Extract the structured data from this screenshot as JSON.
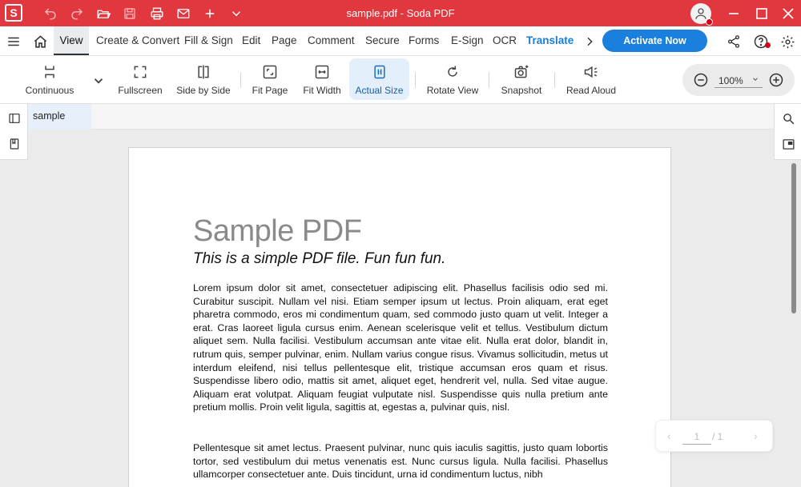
{
  "window": {
    "title": "sample.pdf  -  Soda PDF",
    "app_logo": "S"
  },
  "quick_access": [
    "undo-icon",
    "redo-icon",
    "open-folder-icon",
    "save-icon",
    "print-icon",
    "email-icon",
    "new-plus-icon",
    "chevron-down-icon"
  ],
  "menu": {
    "tabs": [
      "View",
      "Create & Convert",
      "Fill & Sign",
      "Edit",
      "Page",
      "Comment",
      "Secure",
      "Forms",
      "E-Sign",
      "OCR",
      "Translate"
    ],
    "active_tab": "View",
    "activate_label": "Activate Now"
  },
  "toolbar": {
    "tools": [
      {
        "label": "Continuous",
        "icon": "continuous-icon"
      },
      {
        "label": "Fullscreen",
        "icon": "fullscreen-icon"
      },
      {
        "label": "Side by Side",
        "icon": "side-by-side-icon"
      },
      {
        "label": "Fit Page",
        "icon": "fit-page-icon"
      },
      {
        "label": "Fit Width",
        "icon": "fit-width-icon"
      },
      {
        "label": "Actual Size",
        "icon": "actual-size-icon"
      },
      {
        "label": "Rotate View",
        "icon": "rotate-view-icon"
      },
      {
        "label": "Snapshot",
        "icon": "snapshot-icon"
      },
      {
        "label": "Read Aloud",
        "icon": "read-aloud-icon"
      }
    ],
    "active_tool": "Actual Size",
    "zoom": "100%"
  },
  "document_tab": "sample",
  "document": {
    "title": "Sample PDF",
    "subtitle": "This is a simple PDF file. Fun fun fun.",
    "paragraph1": "Lorem ipsum dolor sit amet, consectetuer adipiscing elit. Phasellus facilisis odio sed mi. Curabitur suscipit. Nullam vel nisi. Etiam semper ipsum ut lectus. Proin aliquam, erat eget pharetra commodo, eros mi condimentum quam, sed commodo justo quam ut velit. Integer a erat. Cras laoreet ligula cursus enim. Aenean scelerisque velit et tellus. Vestibulum dictum aliquet sem. Nulla facilisi. Vestibulum accumsan ante vitae elit. Nulla erat dolor, blandit in, rutrum quis, semper pulvinar, enim. Nullam varius congue risus. Vivamus sollicitudin, metus ut interdum eleifend, nisi tellus pellentesque elit, tristique accumsan eros quam et risus. Suspendisse libero odio, mattis sit amet, aliquet eget, hendrerit vel, nulla. Sed vitae augue. Aliquam erat volutpat. Aliquam feugiat vulputate nisl. Suspendisse quis nulla pretium ante pretium mollis. Proin velit ligula, sagittis at, egestas a, pulvinar quis, nisl.",
    "paragraph2": "Pellentesque sit amet lectus. Praesent pulvinar, nunc quis iaculis sagittis, justo quam lobortis tortor, sed vestibulum dui metus venenatis est. Nunc cursus ligula. Nulla facilisi. Phasellus ullamcorper consectetuer ante. Duis tincidunt, urna id condimentum luctus, nibh"
  },
  "pager": {
    "current": "1",
    "total": "/ 1"
  },
  "colors": {
    "titlebar": "#e0383e",
    "accent": "#1b7fde",
    "translate": "#1a7fd4"
  }
}
